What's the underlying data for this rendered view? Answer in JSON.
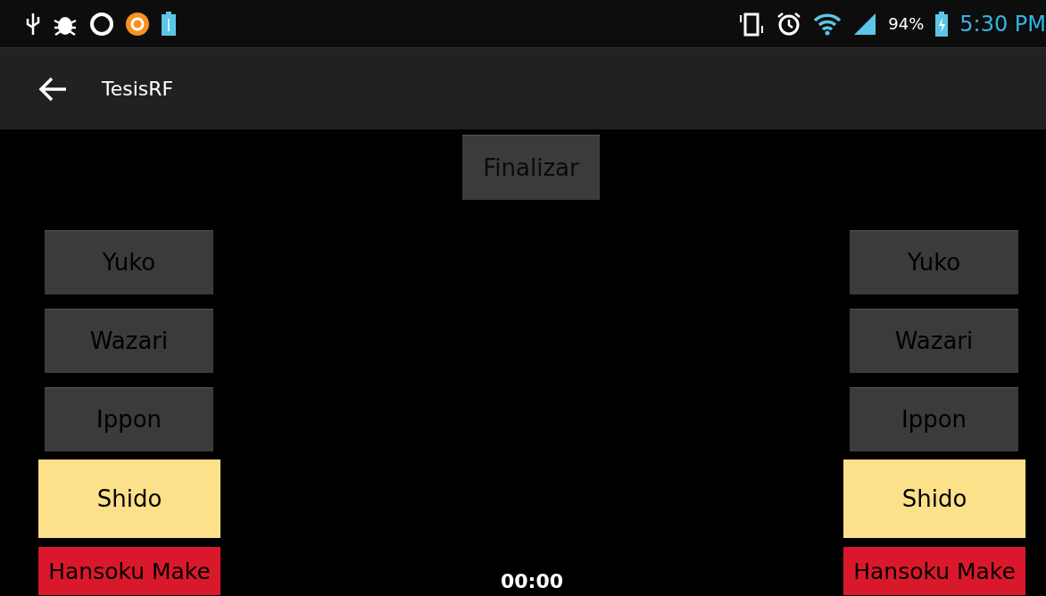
{
  "status_bar": {
    "battery": "94%",
    "time": "5:30 PM"
  },
  "app_bar": {
    "title": "TesisRF"
  },
  "finish_button": "Finalizar",
  "left_buttons": [
    {
      "label": "Yuko",
      "kind": "score"
    },
    {
      "label": "Wazari",
      "kind": "score"
    },
    {
      "label": "Ippon",
      "kind": "score"
    },
    {
      "label": "Shido",
      "kind": "shido"
    },
    {
      "label": "Hansoku Make",
      "kind": "hansoku"
    }
  ],
  "timer": "00:00",
  "right_buttons": [
    {
      "label": "Yuko",
      "kind": "score"
    },
    {
      "label": "Wazari",
      "kind": "score"
    },
    {
      "label": "Ippon",
      "kind": "score"
    },
    {
      "label": "Shido",
      "kind": "shido"
    },
    {
      "label": "Hansoku Make",
      "kind": "hansoku"
    }
  ]
}
